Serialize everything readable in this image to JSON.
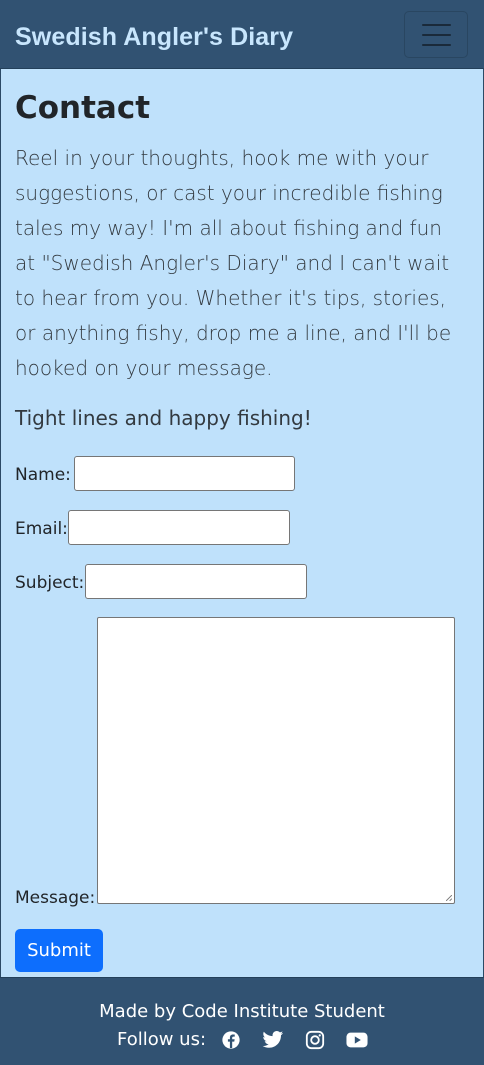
{
  "header": {
    "brand": "Swedish Angler's Diary"
  },
  "main": {
    "title": "Contact",
    "intro": "Reel in your thoughts, hook me with your suggestions, or cast your incredible fishing tales my way! I'm all about fishing and fun at \"Swedish Angler's Diary\" and I can't wait to hear from you. Whether it's tips, stories, or anything fishy, drop me a line, and I'll be hooked on your message.",
    "closing": "Tight lines and happy fishing!"
  },
  "form": {
    "name_label": "Name:",
    "name_value": "",
    "email_label": "Email:",
    "email_value": "",
    "subject_label": "Subject:",
    "subject_value": "",
    "message_label": "Message:",
    "message_value": "",
    "submit_label": "Submit"
  },
  "footer": {
    "credit": "Made by Code Institute Student",
    "follow_label": "Follow us:",
    "social_icons": [
      "facebook-icon",
      "twitter-icon",
      "instagram-icon",
      "youtube-icon"
    ]
  },
  "colors": {
    "navbar": "#315272",
    "brand_text": "#c8e6fd",
    "page_background": "#bfe1fb",
    "submit_button": "#0d6efd"
  }
}
